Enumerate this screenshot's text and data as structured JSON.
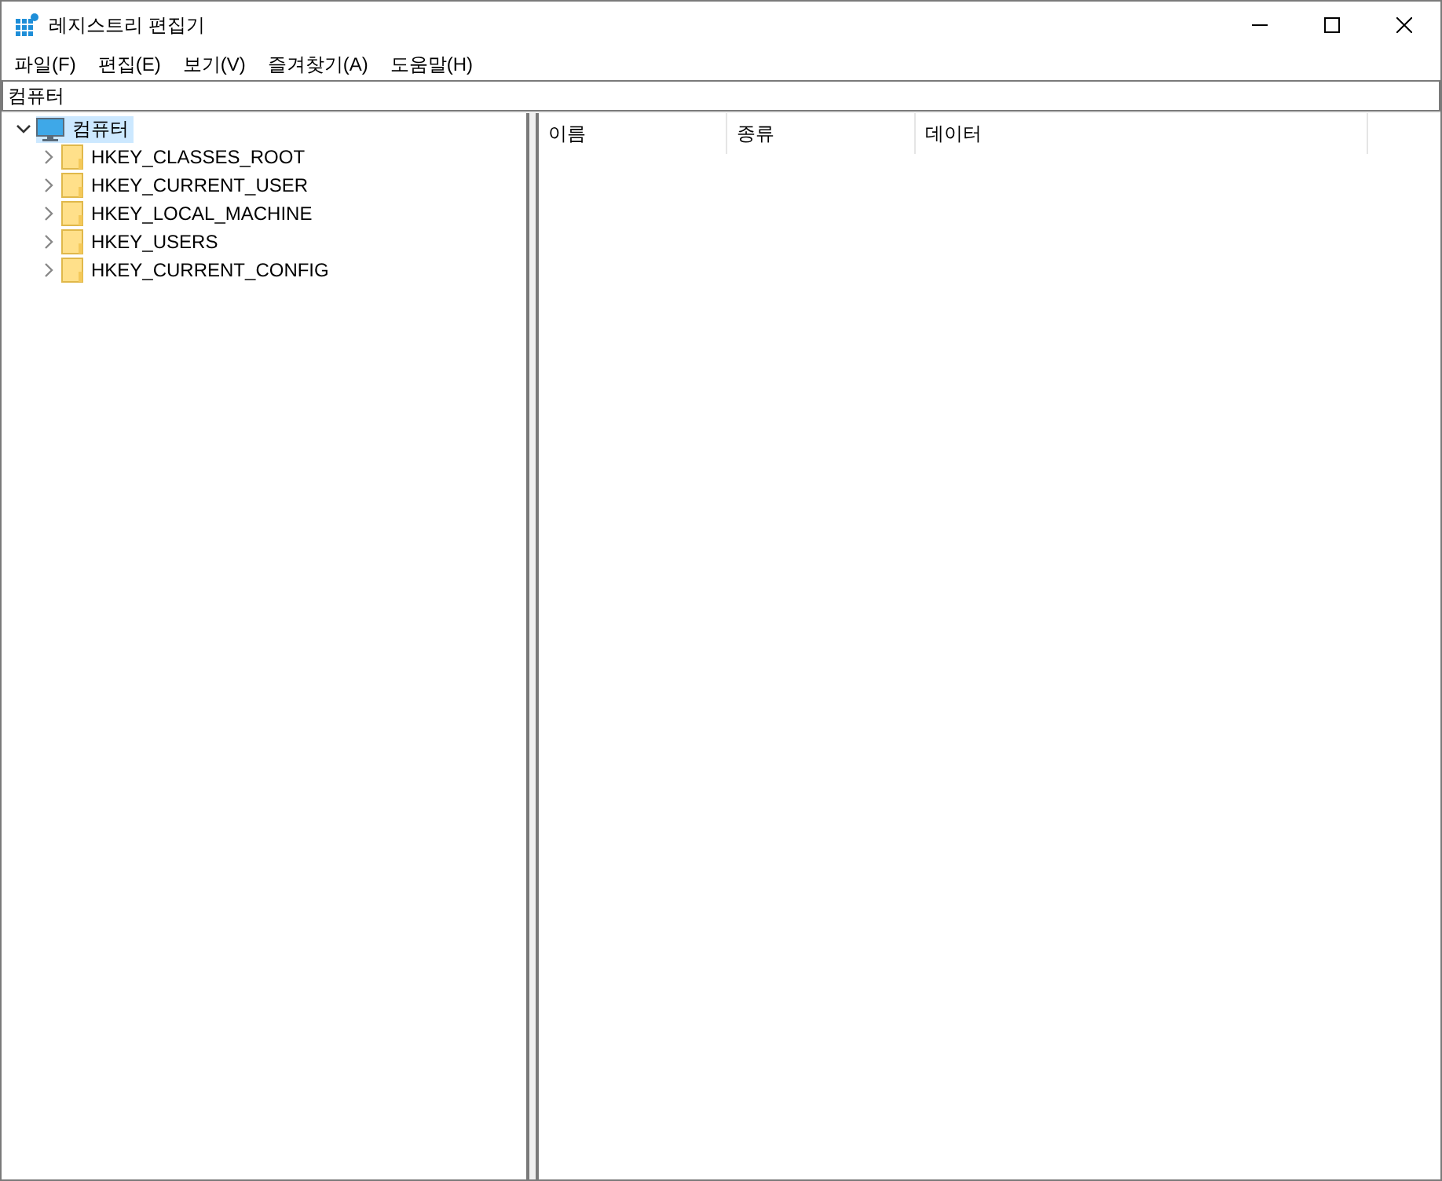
{
  "window": {
    "title": "레지스트리 편집기"
  },
  "menu": [
    "파일(F)",
    "편집(E)",
    "보기(V)",
    "즐겨찾기(A)",
    "도움말(H)"
  ],
  "address": {
    "value": "컴퓨터"
  },
  "tree": [
    {
      "label": "컴퓨터",
      "kind": "computer",
      "expanded": true,
      "selected": true,
      "children": [
        {
          "label": "HKEY_CLASSES_ROOT",
          "kind": "folder",
          "expanded": false,
          "selected": false
        },
        {
          "label": "HKEY_CURRENT_USER",
          "kind": "folder",
          "expanded": false,
          "selected": false
        },
        {
          "label": "HKEY_LOCAL_MACHINE",
          "kind": "folder",
          "expanded": false,
          "selected": false
        },
        {
          "label": "HKEY_USERS",
          "kind": "folder",
          "expanded": false,
          "selected": false
        },
        {
          "label": "HKEY_CURRENT_CONFIG",
          "kind": "folder",
          "expanded": false,
          "selected": false
        }
      ]
    }
  ],
  "table": {
    "columns": [
      "이름",
      "종류",
      "데이터"
    ]
  }
}
